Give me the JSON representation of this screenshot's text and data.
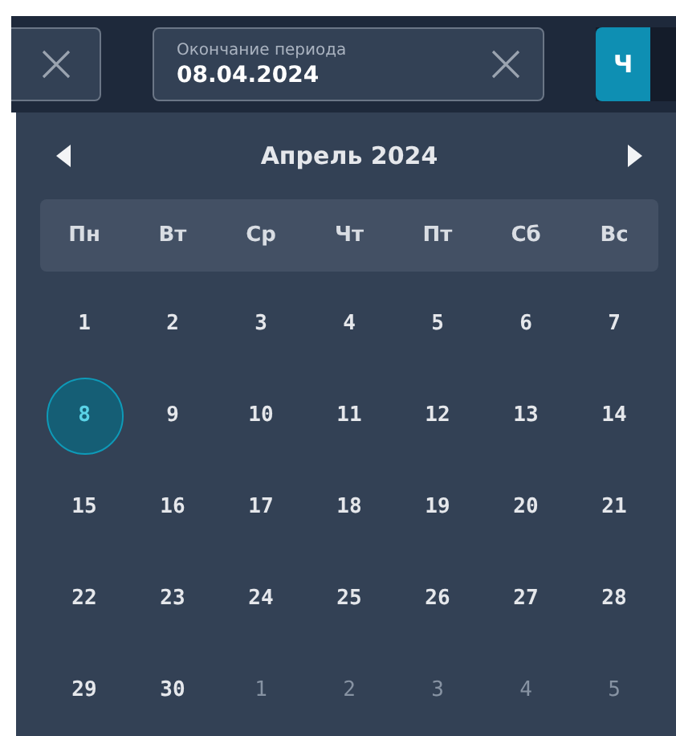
{
  "toolbar": {
    "date_field": {
      "label": "Окончание периода",
      "value": "08.04.2024"
    },
    "mode_buttons": [
      {
        "label": "Ч",
        "selected": true
      }
    ]
  },
  "calendar": {
    "title": "Апрель 2024",
    "weekdays": [
      "Пн",
      "Вт",
      "Ср",
      "Чт",
      "Пт",
      "Сб",
      "Вс"
    ],
    "weeks": [
      [
        {
          "day": "1",
          "outside": false,
          "selected": false
        },
        {
          "day": "2",
          "outside": false,
          "selected": false
        },
        {
          "day": "3",
          "outside": false,
          "selected": false
        },
        {
          "day": "4",
          "outside": false,
          "selected": false
        },
        {
          "day": "5",
          "outside": false,
          "selected": false
        },
        {
          "day": "6",
          "outside": false,
          "selected": false
        },
        {
          "day": "7",
          "outside": false,
          "selected": false
        }
      ],
      [
        {
          "day": "8",
          "outside": false,
          "selected": true
        },
        {
          "day": "9",
          "outside": false,
          "selected": false
        },
        {
          "day": "10",
          "outside": false,
          "selected": false
        },
        {
          "day": "11",
          "outside": false,
          "selected": false
        },
        {
          "day": "12",
          "outside": false,
          "selected": false
        },
        {
          "day": "13",
          "outside": false,
          "selected": false
        },
        {
          "day": "14",
          "outside": false,
          "selected": false
        }
      ],
      [
        {
          "day": "15",
          "outside": false,
          "selected": false
        },
        {
          "day": "16",
          "outside": false,
          "selected": false
        },
        {
          "day": "17",
          "outside": false,
          "selected": false
        },
        {
          "day": "18",
          "outside": false,
          "selected": false
        },
        {
          "day": "19",
          "outside": false,
          "selected": false
        },
        {
          "day": "20",
          "outside": false,
          "selected": false
        },
        {
          "day": "21",
          "outside": false,
          "selected": false
        }
      ],
      [
        {
          "day": "22",
          "outside": false,
          "selected": false
        },
        {
          "day": "23",
          "outside": false,
          "selected": false
        },
        {
          "day": "24",
          "outside": false,
          "selected": false
        },
        {
          "day": "25",
          "outside": false,
          "selected": false
        },
        {
          "day": "26",
          "outside": false,
          "selected": false
        },
        {
          "day": "27",
          "outside": false,
          "selected": false
        },
        {
          "day": "28",
          "outside": false,
          "selected": false
        }
      ],
      [
        {
          "day": "29",
          "outside": false,
          "selected": false
        },
        {
          "day": "30",
          "outside": false,
          "selected": false
        },
        {
          "day": "1",
          "outside": true,
          "selected": false
        },
        {
          "day": "2",
          "outside": true,
          "selected": false
        },
        {
          "day": "3",
          "outside": true,
          "selected": false
        },
        {
          "day": "4",
          "outside": true,
          "selected": false
        },
        {
          "day": "5",
          "outside": true,
          "selected": false
        }
      ]
    ]
  }
}
